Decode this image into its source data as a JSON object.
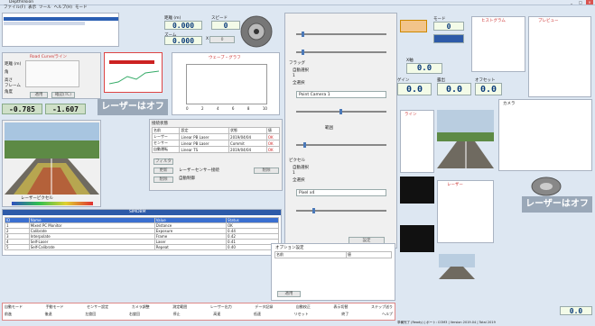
{
  "window": {
    "title": "DepthVision"
  },
  "menu": [
    "ファイル(F)",
    "表示",
    "ツール",
    "ヘルプ(H)",
    "モード"
  ],
  "top_values": {
    "dist_label": "距離 (m)",
    "dist_value": "0.000",
    "speed_label": "スピード",
    "speed_value": "0",
    "zoom_label": "ズーム",
    "zoom_value": "0.000",
    "x_label": "X",
    "x_value": "0"
  },
  "left_panel": {
    "title": "Road Curve/ライン",
    "labels": [
      "距離 (m)",
      "角",
      "高さ",
      "フレーム",
      "角度"
    ],
    "value_a": "-0.785",
    "value_b": "-1.607",
    "apply_label": "適用",
    "clear_label": "確認(TC)"
  },
  "laser_status": {
    "text": "レーザーはオフ"
  },
  "laser_status_right": {
    "text": "レーザーはオフ"
  },
  "chart_panel": {
    "title": "ウェーブ・グラフ",
    "x_axis": [
      "0",
      "2",
      "4",
      "6",
      "8",
      "10"
    ]
  },
  "image_panel": {
    "title": "ステップ(S)",
    "caption": "レーザーピクセル"
  },
  "list_panel": {
    "title": "接続状態",
    "headers": [
      "名前",
      "設定",
      "状態",
      "値"
    ],
    "rows": [
      [
        "レーザー",
        "Linear PB Laser",
        "2019/04/04",
        "OK"
      ],
      [
        "センサー",
        "Linear PB Laser",
        "Commit",
        "OK"
      ],
      [
        "自動運転",
        "Linear TS",
        "2019/04/04",
        "OK"
      ]
    ],
    "buttons": [
      "フィルタ",
      "更新",
      "削除",
      "削除"
    ],
    "options": [
      "レーザーセンサー接続",
      "自動制御"
    ]
  },
  "center_controls": {
    "section_a": "フラッグ",
    "radio_a": [
      "自動選択",
      "1",
      "全選択"
    ],
    "dropdown_a": "Point Camera 1",
    "range_label": "範囲",
    "section_b": "ピクセル",
    "radio_b": [
      "自動選択",
      "1",
      "全選択"
    ],
    "dropdown_b": "Pixel x4",
    "button_label": "設定"
  },
  "right_values": {
    "mode_label": "モード",
    "mode_value": "0",
    "x_label": "X軸",
    "x_value": "0.0",
    "gain_label": "ゲイン",
    "gain_value": "0.0",
    "exposure_label": "露出",
    "exposure_value": "0.0",
    "offset_label": "オフセット",
    "offset_value": "0.0"
  },
  "side_panels": {
    "histogram_title": "ヒストグラム",
    "preview_title": "プレビュー",
    "line_title": "ライン",
    "camera_title": "カメラ",
    "laser_title": "レーザー"
  },
  "bottom_table": {
    "title": "SIMDBM",
    "headers": [
      "ID",
      "Name",
      "Value",
      "Status"
    ],
    "rows": [
      [
        "1",
        "Mixed PC Monitor",
        "Distance",
        "OK"
      ],
      [
        "2",
        "Calibrate",
        "Exposure",
        "0.44"
      ],
      [
        "3",
        "Interpolate",
        "Frame",
        "0.42"
      ],
      [
        "4",
        "Self-Laser",
        "Laser",
        "0.41"
      ],
      [
        "5",
        "Self-Calibrate",
        "Repeat",
        "0.40"
      ]
    ]
  },
  "option_panel": {
    "title": "オプション設定",
    "headers": [
      "名前",
      "値"
    ],
    "button": "適用"
  },
  "footer": {
    "row1": [
      "自動モード",
      "手動モード",
      "センサー設定",
      "カメラ調整",
      "測定範囲",
      "レーザー出力",
      "データ記録",
      "自動校正",
      "表示切替",
      "ステップ送り"
    ],
    "row2": [
      "前進",
      "後退",
      "左旋回",
      "右旋回",
      "停止",
      "高速",
      "低速",
      "リセット",
      "終了",
      "ヘルプ"
    ],
    "status": "準備完了 (Ready) | ポート: COM3 | Version 2019.04 | Total 2019",
    "corner_value": "0.0"
  }
}
